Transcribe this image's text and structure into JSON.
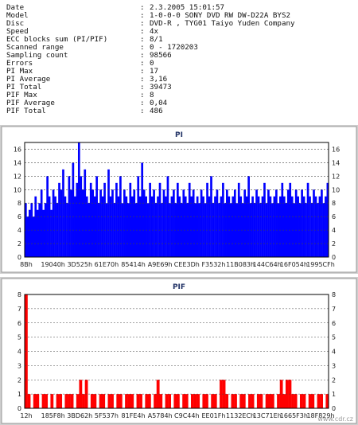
{
  "info": [
    {
      "key": "Date",
      "value": "2.3.2005 15:01:57"
    },
    {
      "key": "Model",
      "value": "1-0-0-0 SONY     DVD RW DW-D22A    BYS2"
    },
    {
      "key": "Disc",
      "value": "DVD-R , TYG01  Taiyo Yuden Company"
    },
    {
      "key": "Speed",
      "value": "4x"
    },
    {
      "key": "ECC blocks sum (PI/PIF)",
      "value": "8/1"
    },
    {
      "key": "Scanned range",
      "value": "0 - 1720203"
    },
    {
      "key": "Sampling count",
      "value": "98566"
    },
    {
      "key": "Errors",
      "value": "0"
    },
    {
      "key": "PI Max",
      "value": "17"
    },
    {
      "key": "PI Average",
      "value": "3,16"
    },
    {
      "key": "PI Total",
      "value": "39473"
    },
    {
      "key": "PIF Max",
      "value": "8"
    },
    {
      "key": "PIF Average",
      "value": "0,04"
    },
    {
      "key": "PIF Total",
      "value": "486"
    }
  ],
  "watermark": "www.cdr.cz",
  "chart_data": [
    {
      "type": "bar",
      "title": "PI",
      "color": "#0000ff",
      "ylim": [
        0,
        17
      ],
      "yticks": [
        0,
        2,
        4,
        6,
        8,
        10,
        12,
        14,
        16
      ],
      "categories": [
        "8Bh",
        "19040h",
        "3D525h",
        "61E70h",
        "85414h",
        "A9E69h",
        "CEE3Dh",
        "F3532h",
        "11B083h",
        "144C64h",
        "16F054h",
        "1995CFh"
      ],
      "grid": true,
      "max": 17,
      "average": 3.16,
      "series": [
        {
          "values": [
            8,
            6,
            7,
            8,
            6,
            9,
            7,
            8,
            10,
            7,
            8,
            12,
            9,
            7,
            10,
            9,
            8,
            11,
            10,
            13,
            9,
            8,
            12,
            10,
            14,
            9,
            11,
            17,
            12,
            10,
            13,
            9,
            8,
            11,
            10,
            9,
            12,
            8,
            10,
            9,
            11,
            8,
            13,
            9,
            10,
            8,
            11,
            9,
            12,
            8,
            10,
            9,
            8,
            11,
            9,
            10,
            8,
            12,
            9,
            14,
            10,
            9,
            8,
            11,
            9,
            10,
            8,
            9,
            11,
            8,
            10,
            9,
            12,
            8,
            9,
            10,
            8,
            11,
            9,
            8,
            10,
            9,
            8,
            11,
            9,
            10,
            8,
            9,
            8,
            10,
            9,
            8,
            11,
            9,
            12,
            8,
            9,
            10,
            8,
            9,
            11,
            8,
            10,
            9,
            8,
            9,
            10,
            8,
            11,
            9,
            8,
            10,
            9,
            12,
            8,
            9,
            8,
            10,
            9,
            8,
            9,
            11,
            8,
            10,
            9,
            8,
            9,
            10,
            8,
            9,
            11,
            9,
            8,
            10,
            11,
            9,
            8,
            10,
            9,
            8,
            10,
            9,
            8,
            11,
            9,
            8,
            10,
            9,
            8,
            9,
            10,
            8,
            9,
            11
          ]
        }
      ]
    },
    {
      "type": "bar",
      "title": "PIF",
      "color": "#ff0000",
      "ylim": [
        0,
        8
      ],
      "yticks": [
        0,
        1,
        2,
        3,
        4,
        5,
        6,
        7,
        8
      ],
      "categories": [
        "12h",
        "185F8h",
        "3BD62h",
        "5F537h",
        "81FE4h",
        "A5784h",
        "C9C44h",
        "EE01Fh",
        "1132ECh",
        "13C71Eh",
        "1665F3h",
        "18F829h"
      ],
      "grid": true,
      "max": 8,
      "average": 0.04,
      "series": [
        {
          "values": [
            8,
            1,
            0,
            1,
            1,
            0,
            1,
            1,
            0,
            1,
            0,
            1,
            1,
            0,
            1,
            1,
            1,
            0,
            1,
            2,
            1,
            2,
            0,
            1,
            1,
            0,
            1,
            1,
            0,
            1,
            1,
            0,
            1,
            1,
            0,
            1,
            1,
            1,
            0,
            1,
            1,
            0,
            1,
            1,
            0,
            1,
            2,
            1,
            0,
            1,
            1,
            0,
            1,
            1,
            0,
            1,
            1,
            0,
            1,
            1,
            1,
            0,
            1,
            1,
            0,
            1,
            1,
            0,
            2,
            2,
            1,
            0,
            1,
            1,
            0,
            1,
            1,
            0,
            1,
            1,
            0,
            1,
            1,
            0,
            1,
            1,
            1,
            0,
            1,
            2,
            1,
            2,
            2,
            1,
            1,
            0,
            1,
            1,
            0,
            1,
            1,
            0,
            1,
            1,
            0,
            1
          ]
        }
      ]
    }
  ]
}
